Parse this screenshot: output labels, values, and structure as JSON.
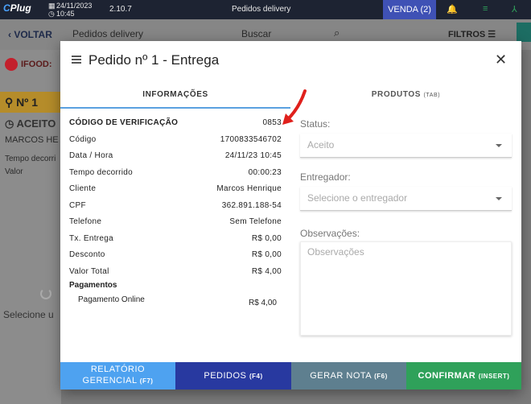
{
  "topbar": {
    "logo": "Plug",
    "logo_prefix": "C",
    "date": "24/11/2023",
    "time": "10:45",
    "version": "2.10.7",
    "title": "Pedidos delivery",
    "venda": "VENDA (2)"
  },
  "subbar": {
    "voltar": "VOLTAR",
    "page": "Pedidos delivery",
    "search_placeholder": "Buscar",
    "filtros": "FILTROS"
  },
  "left": {
    "ifood": "IFOOD:",
    "order_no": "Nº 1",
    "status": "ACEITO",
    "customer": "MARCOS HE",
    "elapsed": "Tempo decorri",
    "value": "Valor",
    "select": "Selecione u"
  },
  "modal": {
    "title": "Pedido nº 1 - Entrega",
    "tabs": {
      "info": "INFORMAÇÕES",
      "products": "PRODUTOS",
      "products_key": "(TAB)"
    },
    "info_rows": [
      {
        "label": "CÓDIGO DE VERIFICAÇÃO",
        "value": "0853"
      },
      {
        "label": "Código",
        "value": "1700833546702"
      },
      {
        "label": "Data / Hora",
        "value": "24/11/23 10:45"
      },
      {
        "label": "Tempo decorrido",
        "value": "00:00:23"
      },
      {
        "label": "Cliente",
        "value": "Marcos Henrique"
      },
      {
        "label": "CPF",
        "value": "362.891.188-54"
      },
      {
        "label": "Telefone",
        "value": "Sem Telefone"
      },
      {
        "label": "Tx. Entrega",
        "value": "R$ 0,00"
      },
      {
        "label": "Desconto",
        "value": "R$ 0,00"
      },
      {
        "label": "Valor Total",
        "value": "R$ 4,00"
      }
    ],
    "payments_header": "Pagamentos",
    "payment": {
      "label": "Pagamento Online",
      "value": "R$ 4,00"
    },
    "form": {
      "status_label": "Status:",
      "status_value": "Aceito",
      "courier_label": "Entregador:",
      "courier_placeholder": "Selecione o entregador",
      "notes_label": "Observações:",
      "notes_placeholder": "Observações"
    },
    "buttons": {
      "report_line1": "RELATÓRIO",
      "report_line2": "GERENCIAL",
      "report_key": "(F7)",
      "orders": "PEDIDOS",
      "orders_key": "(F4)",
      "invoice": "GERAR NOTA",
      "invoice_key": "(F6)",
      "confirm": "CONFIRMAR",
      "confirm_key": "(INSERT)"
    }
  },
  "colors": {
    "topbar": "#1d2332",
    "tab_indicator": "#5aa0e0",
    "btn_report": "#4ea2f0",
    "btn_orders": "#2839a0",
    "btn_invoice": "#5e7f8f",
    "btn_confirm": "#2fa15a",
    "arrow": "#e0201c"
  }
}
